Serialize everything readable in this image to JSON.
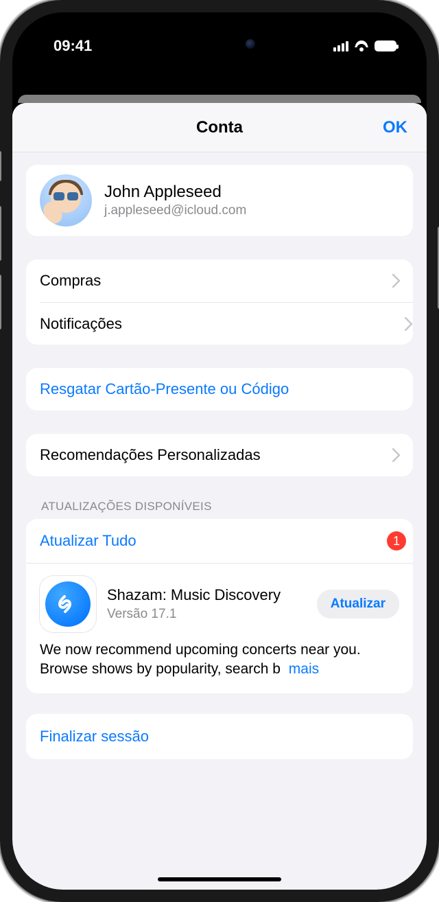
{
  "status": {
    "time": "09:41"
  },
  "nav": {
    "title": "Conta",
    "done": "OK"
  },
  "profile": {
    "name": "John Appleseed",
    "email": "j.appleseed@icloud.com"
  },
  "menu": {
    "purchases": "Compras",
    "notifications": "Notificações",
    "redeem": "Resgatar Cartão-Presente ou Código",
    "personalized": "Recomendações Personalizadas"
  },
  "updates": {
    "header": "ATUALIZAÇÕES DISPONÍVEIS",
    "update_all": "Atualizar Tudo",
    "badge": "1",
    "app": {
      "name": "Shazam: Music Discovery",
      "version": "Versão 17.1",
      "update_button": "Atualizar",
      "notes_line": "We now recommend upcoming concerts near you. Browse shows by popularity, search b",
      "more": "mais"
    }
  },
  "signout": "Finalizar sessão"
}
